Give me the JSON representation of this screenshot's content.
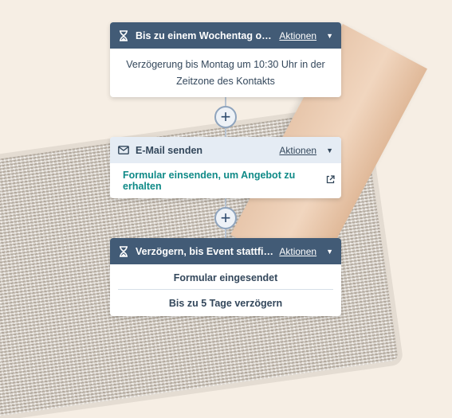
{
  "step1": {
    "icon": "hourglass-icon",
    "title": "Bis zu einem Wochentag oder ein...",
    "actions_label": "Aktionen",
    "body": "Verzögerung bis Montag um 10:30 Uhr in der Zeitzone des Kontakts"
  },
  "add_button_symbol": "+",
  "step2": {
    "icon": "envelope-icon",
    "title": "E-Mail senden",
    "actions_label": "Aktionen",
    "link_text": "Formular einsenden, um Angebot zu erhalten",
    "link_icon": "external-link-icon"
  },
  "step3": {
    "icon": "hourglass-icon",
    "title": "Verzögern, bis Event stattfindet",
    "actions_label": "Aktionen",
    "rows": [
      "Formular eingesendet",
      "Bis zu 5 Tage verzögern"
    ]
  },
  "colors": {
    "header_dark": "#425b76",
    "header_light": "#e5ecf4",
    "link": "#0f8a87",
    "background": "#f6eee4"
  }
}
